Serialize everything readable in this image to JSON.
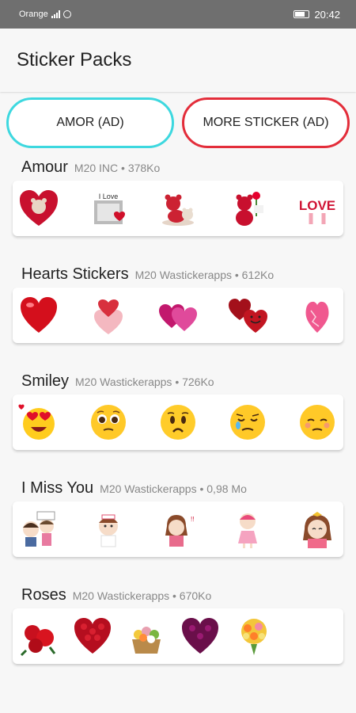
{
  "status": {
    "carrier": "Orange",
    "time": "20:42"
  },
  "appbar": {
    "title": "Sticker Packs"
  },
  "ads": [
    {
      "label": "AMOR (AD)",
      "color": "#3dd8df"
    },
    {
      "label": "MORE STICKER (AD)",
      "color": "#e32d3a"
    }
  ],
  "packs": [
    {
      "name": "Amour",
      "meta": "M20 INC • 378Ko",
      "stickers": [
        "heart-bear-sticker",
        "love-gift-sticker",
        "teddy-bear-sticker",
        "bear-with-rose-sticker",
        "love-text-sticker"
      ]
    },
    {
      "name": "Hearts Stickers",
      "meta": "M20 Wastickerapps • 612Ko",
      "stickers": [
        "red-heart-sticker",
        "stacked-hearts-sticker",
        "pink-hearts-sticker",
        "smiling-hearts-sticker",
        "pink-heart-sticker"
      ]
    },
    {
      "name": "Smiley",
      "meta": "M20 Wastickerapps • 726Ko",
      "stickers": [
        "heart-eyes-emoji",
        "pleading-emoji",
        "worried-emoji",
        "crying-emoji",
        "shy-emoji"
      ]
    },
    {
      "name": "I Miss You",
      "meta": "M20 Wastickerapps • 0,98 Mo",
      "stickers": [
        "couple-sticker",
        "nurse-girl-sticker",
        "girl-hug-sticker",
        "girl-dress-sticker",
        "crying-girl-sticker"
      ]
    },
    {
      "name": "Roses",
      "meta": "M20 Wastickerapps • 670Ko",
      "stickers": [
        "red-roses-sticker",
        "rose-heart-sticker",
        "flower-basket-sticker",
        "purple-rose-heart-sticker",
        "bouquet-sticker"
      ]
    }
  ]
}
